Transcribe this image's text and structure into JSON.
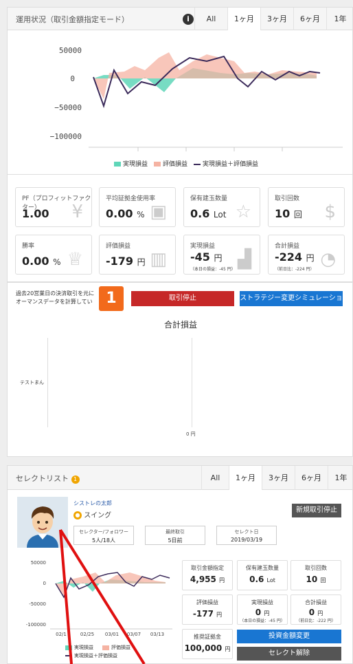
{
  "header": {
    "title": "運用状況（取引金額指定モード）",
    "tabs": [
      "All",
      "1ヶ月",
      "3ヶ月",
      "6ヶ月",
      "1年"
    ],
    "active_tab": "1ヶ月"
  },
  "main_chart": {
    "y_ticks": [
      "50000",
      "0",
      "−50000",
      "−100000"
    ],
    "legend": [
      "実現損益",
      "評価損益",
      "実現損益＋評価損益"
    ]
  },
  "stats": [
    {
      "label": "PF（プロフィットファクター）",
      "value": "1.00",
      "unit": "",
      "sub": "",
      "icon": "yen-icon"
    },
    {
      "label": "平均証拠金使用率",
      "value": "0.00",
      "unit": "%",
      "sub": "",
      "icon": "wallet-icon"
    },
    {
      "label": "保有建玉数量",
      "value": "0.6",
      "unit": "Lot",
      "sub": "",
      "icon": "star-icon"
    },
    {
      "label": "取引回数",
      "value": "10",
      "unit": "回",
      "sub": "",
      "icon": "dollar-cycle-icon"
    },
    {
      "label": "勝率",
      "value": "0.00",
      "unit": "%",
      "sub": "",
      "icon": "trophy-icon"
    },
    {
      "label": "評価損益",
      "value": "-179",
      "unit": "円",
      "sub": "",
      "icon": "bar-chart-icon"
    },
    {
      "label": "実現損益",
      "value": "-45",
      "unit": "円",
      "sub": "（本日の損益：-45 円）",
      "icon": "trend-chart-icon"
    },
    {
      "label": "合計損益",
      "value": "-224",
      "unit": "円",
      "sub": "（前日比：-224 円）",
      "icon": "pie-chart-icon"
    }
  ],
  "action": {
    "note": "過去20営業日の決済取引を元に\nオーマンスデータを計算してい",
    "badge": "1",
    "stop_label": "取引停止",
    "sim_label": "ストラテジー変更シミュレーション"
  },
  "total_chart": {
    "title": "合計損益",
    "y_label": "テストまん",
    "x_label": "0 円"
  },
  "select_header": {
    "title": "セレクトリスト",
    "count": "1",
    "tabs": [
      "All",
      "1ヶ月",
      "3ヶ月",
      "6ヶ月",
      "1年"
    ],
    "active_tab": "1ヶ月"
  },
  "strategy": {
    "name": "シストレの太郎",
    "style": "スイング",
    "stop_new_label": "新規取引停止",
    "info": [
      {
        "label": "セレクター/フォロワー",
        "value": "5人/18人"
      },
      {
        "label": "最終取引",
        "value": "5日前"
      },
      {
        "label": "セレクト日",
        "value": "2019/03/19"
      }
    ],
    "mini_y": [
      "50000",
      "0",
      "-50000",
      "-100000"
    ],
    "mini_x": [
      "02/1",
      "02/25",
      "03/01",
      "03/07",
      "03/13"
    ],
    "mini_legend": [
      "実現損益",
      "評価損益",
      "実現損益＋評価損益"
    ],
    "metrics": [
      {
        "label": "取引金額指定",
        "value": "4,955",
        "unit": "円",
        "sub": ""
      },
      {
        "label": "保有建玉数量",
        "value": "0.6",
        "unit": "Lot",
        "sub": ""
      },
      {
        "label": "取引回数",
        "value": "10",
        "unit": "回",
        "sub": ""
      },
      {
        "label": "評価損益",
        "value": "-177",
        "unit": "円",
        "sub": ""
      },
      {
        "label": "実現損益",
        "value": "0",
        "unit": "円",
        "sub": "（本日の損益：-45 円）"
      },
      {
        "label": "合計損益",
        "value": "0",
        "unit": "円",
        "sub": "（前日比：-222 円）"
      }
    ],
    "margin_label": "推奨証拠金",
    "margin_value": "100,000",
    "margin_unit": "円",
    "invest_label": "投資金額変更",
    "deselect_label": "セレクト解除"
  },
  "colors": {
    "realized": "#5fd6b8",
    "unrealized": "#f5b3a3",
    "total": "#3b2a5a",
    "accent_orange": "#f26a1b"
  }
}
